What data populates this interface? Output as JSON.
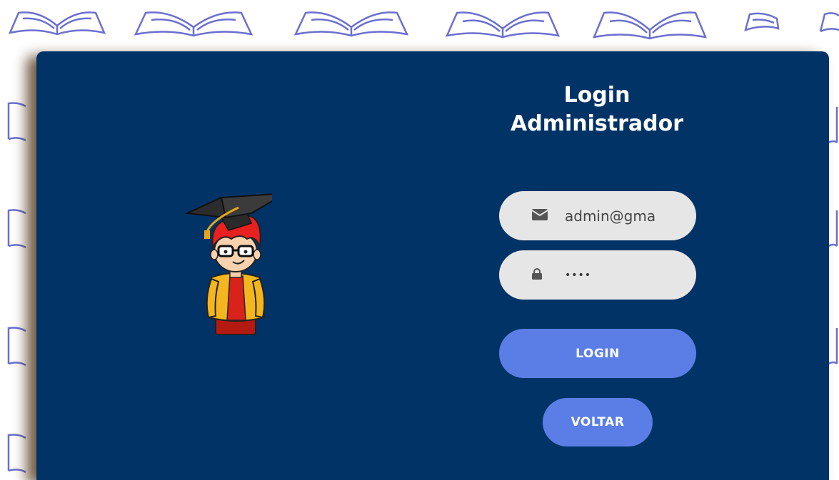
{
  "title": {
    "line1": "Login",
    "line2": "Administrador"
  },
  "email": {
    "value": "admin@gma",
    "icon": "envelope-icon"
  },
  "password": {
    "value": "••••",
    "icon": "lock-icon"
  },
  "buttons": {
    "login": "LOGIN",
    "back": "VOLTAR"
  },
  "colors": {
    "panel": "#023366",
    "accent": "#5b7ee6",
    "field": "#e6e6e6",
    "pattern": "#6b6fd0"
  }
}
